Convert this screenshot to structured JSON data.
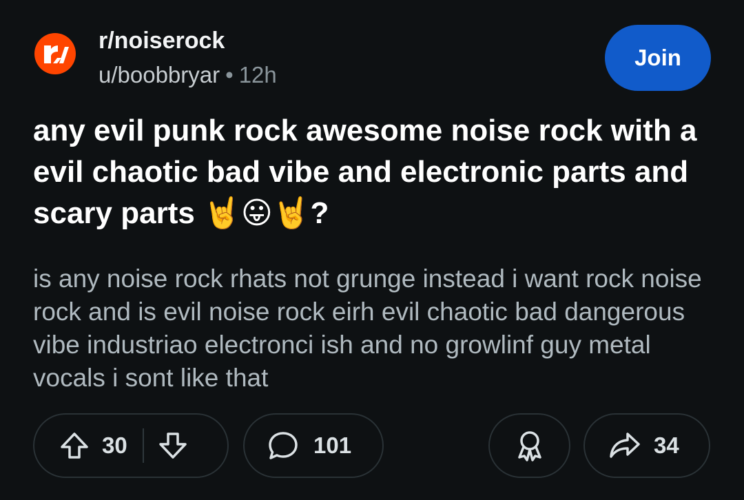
{
  "post": {
    "subreddit": "r/noiserock",
    "author": "u/boobbryar",
    "separator": "•",
    "time_ago": "12h",
    "join_label": "Join",
    "title": "any evil punk rock awesome noise rock with a evil chaotic bad vibe and electronic parts and scary parts 🤘😛🤘?",
    "body": "is any noise rock rhats not grunge instead i want rock noise rock and is evil noise rock eirh evil chaotic bad dangerous vibe industriao electronci ish and no growlinf guy metal vocals i sont like that"
  },
  "actions": {
    "upvotes": "30",
    "comments": "101",
    "shares": "34"
  },
  "colors": {
    "background": "#0e1113",
    "subreddit_icon": "#ff4500",
    "join_button": "#115bca"
  },
  "icons": [
    "subreddit-logo-icon",
    "upvote-icon",
    "downvote-icon",
    "comment-icon",
    "award-icon",
    "share-icon"
  ]
}
